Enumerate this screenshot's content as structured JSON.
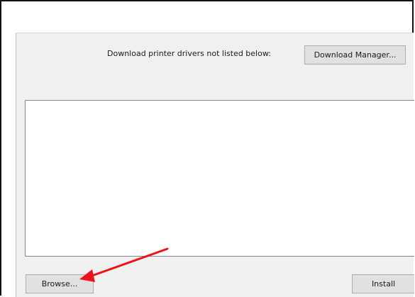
{
  "dialog": {
    "download_prompt": "Download printer drivers not listed below:",
    "download_manager_label": "Download Manager...",
    "browse_label": "Browse...",
    "install_label": "Install"
  },
  "annotation": {
    "arrow_icon": "red-arrow-icon",
    "arrow_color": "#e8141b"
  }
}
